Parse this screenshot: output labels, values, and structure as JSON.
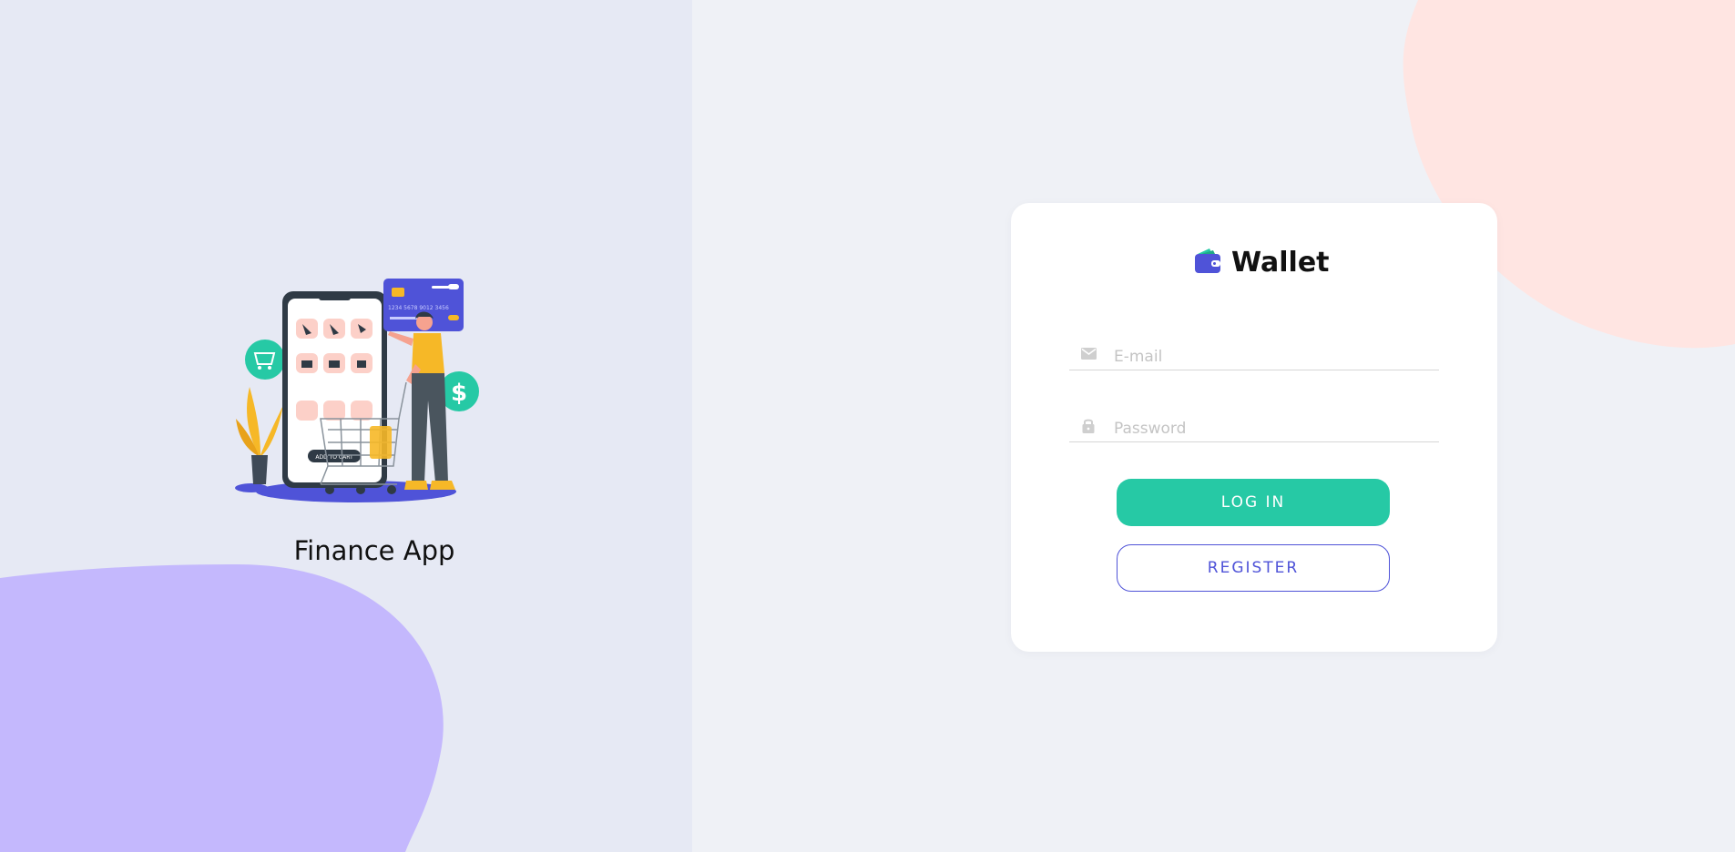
{
  "left_panel": {
    "app_title": "Finance App",
    "illustration": {
      "icon": "shopping-app-illustration",
      "phone_button_label": "ADD TO CART",
      "card_number": "1234 5678 9012 3456"
    }
  },
  "login_card": {
    "brand_name": "Wallet",
    "brand_icon": "wallet-icon",
    "email_field": {
      "icon": "mail-icon",
      "placeholder": "E-mail",
      "value": ""
    },
    "password_field": {
      "icon": "lock-icon",
      "placeholder": "Password",
      "value": ""
    },
    "login_button": "LOG IN",
    "register_button": "REGISTER"
  },
  "colors": {
    "left_background": "#e6e9f4",
    "right_background": "#eff1f6",
    "purple_blob": "#c4b8fd",
    "peach_blob": "#ffe5e2",
    "primary_teal": "#26c9a5",
    "accent_indigo": "#4f53d8"
  }
}
